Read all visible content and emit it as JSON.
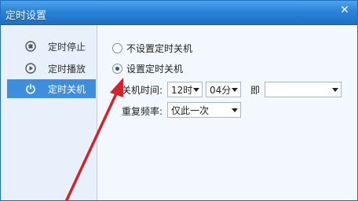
{
  "window": {
    "title": "定时设置",
    "close_glyph": "✕"
  },
  "sidebar": {
    "items": [
      {
        "label": "定时停止",
        "icon": "stop-icon"
      },
      {
        "label": "定时播放",
        "icon": "play-icon"
      },
      {
        "label": "定时关机",
        "icon": "power-icon"
      }
    ],
    "active_index": 2
  },
  "options": {
    "no_shutdown_label": "不设置定时关机",
    "set_shutdown_label": "设置定时关机",
    "selected": "set_shutdown"
  },
  "shutdown_time": {
    "label": "关机时间:",
    "hour": "12时",
    "minute": "04分",
    "immediate_label": "即",
    "extra_value": ""
  },
  "repeat": {
    "label": "重复频率:",
    "value": "仅此一次"
  },
  "colors": {
    "titlebar": "#2b84d8",
    "active_item": "#3d8fde",
    "annotation_arrow": "#d2232a"
  }
}
